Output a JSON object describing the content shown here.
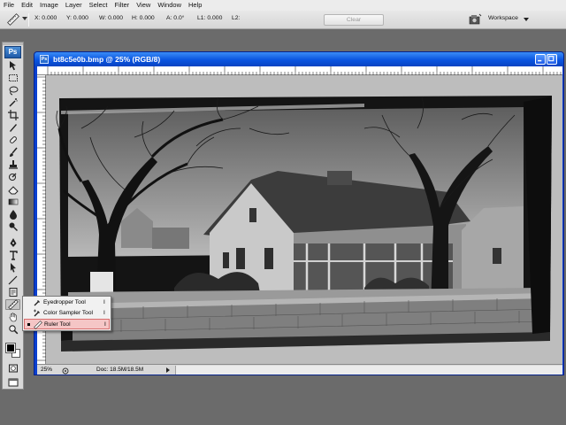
{
  "menu": {
    "items": [
      "File",
      "Edit",
      "Image",
      "Layer",
      "Select",
      "Filter",
      "View",
      "Window",
      "Help"
    ]
  },
  "options_bar": {
    "tool_icon": "ruler-icon",
    "fields": {
      "x": "X: 0.000",
      "y": "Y: 0.000",
      "w": "W: 0.000",
      "h": "H: 0.000",
      "a": "A: 0.0°",
      "l1": "L1: 0.000",
      "l2": "L2:"
    },
    "clear_label": "Clear",
    "workspace_label": "Workspace"
  },
  "toolbox": {
    "logo": "Ps"
  },
  "document": {
    "title": "bt8c5e0b.bmp @ 25% (RGB/8)",
    "zoom": "25%",
    "info": "Doc: 18.5M/18.5M"
  },
  "flyout": {
    "items": [
      {
        "label": "Eyedropper Tool",
        "shortcut": "I",
        "icon": "eyedropper-icon",
        "selected": false
      },
      {
        "label": "Color Sampler Tool",
        "shortcut": "I",
        "icon": "color-sampler-icon",
        "selected": false
      },
      {
        "label": "Ruler Tool",
        "shortcut": "I",
        "icon": "ruler-icon",
        "selected": true
      }
    ]
  },
  "colors": {
    "title_bar": "#0a54e0",
    "canvas_bg": "#bdbdbd",
    "app_bg": "#6b6b6b",
    "selected_item": "#f5c6c6"
  }
}
